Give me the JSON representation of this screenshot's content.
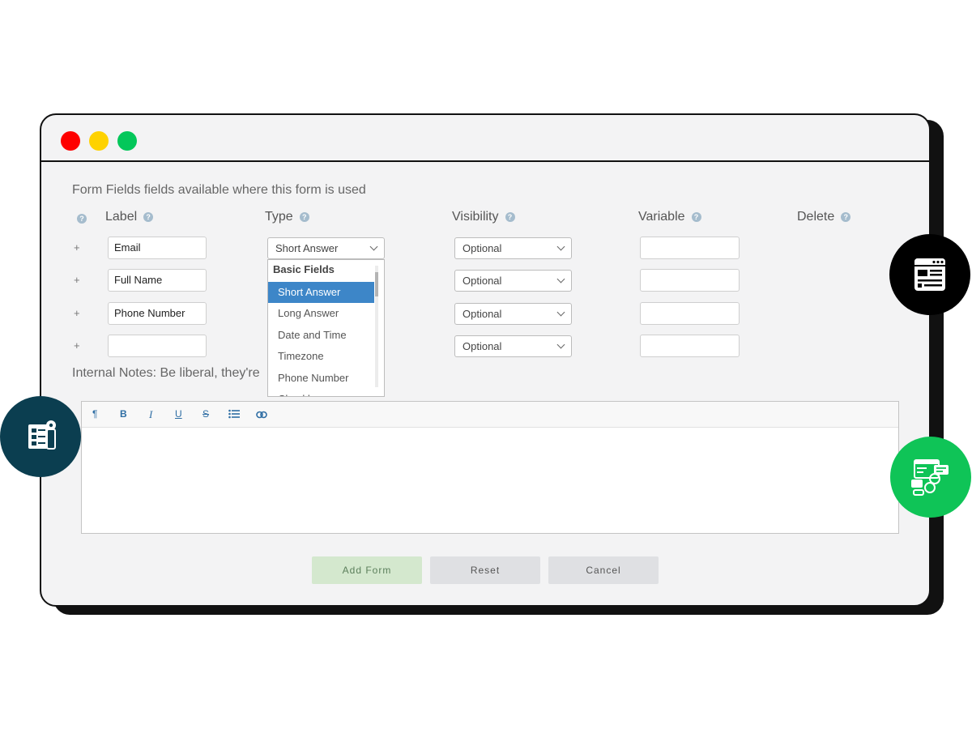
{
  "intro_text": "Form Fields fields available where this form is used",
  "columns": {
    "label": "Label",
    "type": "Type",
    "visibility": "Visibility",
    "variable": "Variable",
    "delete": "Delete"
  },
  "help_glyph": "?",
  "plus_glyph": "+",
  "rows": [
    {
      "label": "Email",
      "type": "Short Answer",
      "visibility": "Optional",
      "variable": ""
    },
    {
      "label": "Full Name",
      "visibility": "Optional",
      "variable": ""
    },
    {
      "label": "Phone Number",
      "visibility": "Optional",
      "variable": ""
    },
    {
      "label": "",
      "visibility": "Optional",
      "variable": ""
    }
  ],
  "type_dropdown": {
    "group": "Basic Fields",
    "items": [
      "Short Answer",
      "Long Answer",
      "Date and Time",
      "Timezone",
      "Phone Number",
      "Checkbox"
    ],
    "selected": "Short Answer"
  },
  "notes_label": "Internal Notes: Be liberal, they're",
  "editor_toolbar": {
    "paragraph": "¶",
    "bold": "B",
    "italic": "I",
    "underline": "U",
    "strikethrough": "S"
  },
  "buttons": {
    "add": "Add Form",
    "reset": "Reset",
    "cancel": "Cancel"
  },
  "colors": {
    "accent": "#3d86c8",
    "add_button": "#d4e8ce",
    "dot_red": "#fe0000",
    "dot_yellow": "#fed200",
    "dot_green": "#03c75a",
    "badge_teal": "#0b3e50",
    "badge_green": "#0fc457"
  }
}
